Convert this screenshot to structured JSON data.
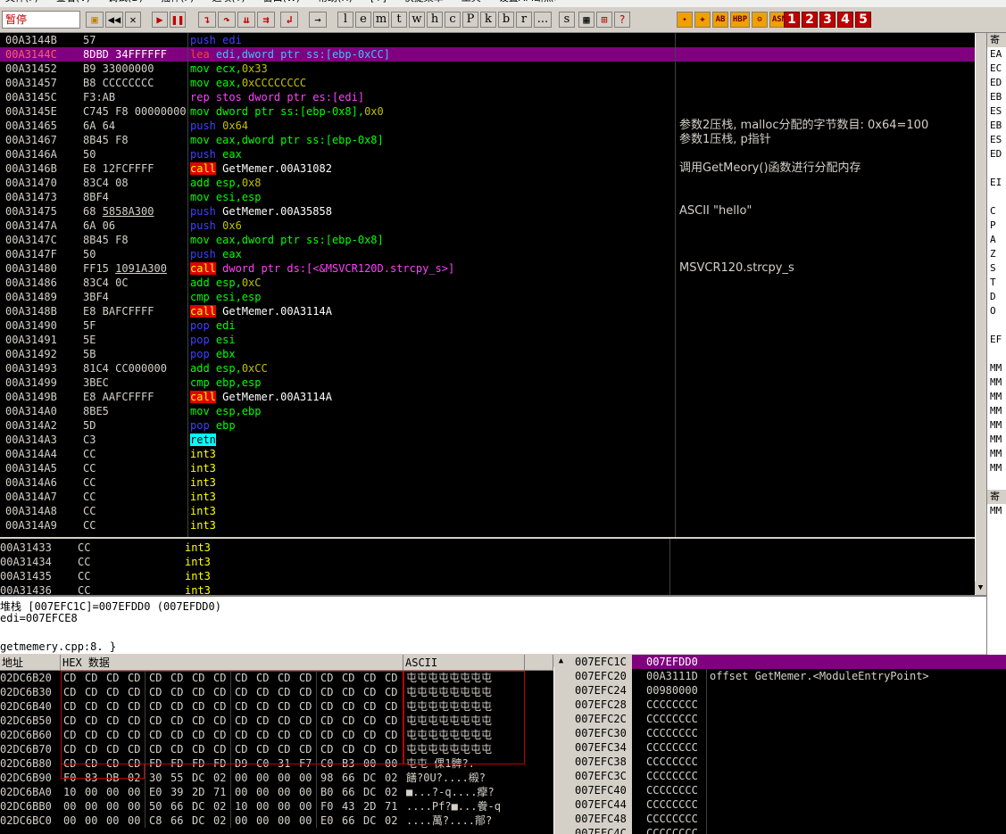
{
  "menu": {
    "items": [
      "文件(F)",
      "查看(V)",
      "调试(D)",
      "插件(P)",
      "选项(T)",
      "窗口(W)",
      "帮助(H)",
      "[+]",
      "快捷菜单",
      "工具",
      "设置API断点>"
    ]
  },
  "toolbar": {
    "status": "暂停",
    "letters": [
      "l",
      "e",
      "m",
      "t",
      "w",
      "h",
      "c",
      "P",
      "k",
      "b",
      "r",
      "...",
      "s"
    ],
    "plugins": [
      "HBP",
      "ASM"
    ],
    "numbers": [
      "1",
      "2",
      "3",
      "4",
      "5"
    ]
  },
  "disasm": [
    {
      "addr": "00A3144B",
      "hex": "57",
      "ins": [
        [
          "push",
          "c-push"
        ],
        [
          " edi",
          "c-push"
        ]
      ],
      "comment": ""
    },
    {
      "addr": "00A3144C",
      "hex": "8DBD 34FFFFFF",
      "ins": [
        [
          "lea",
          "c-rep"
        ],
        [
          " edi,dword ptr ss:[ebp-0xCC]",
          "c-push2"
        ]
      ],
      "comment": "",
      "selected": true
    },
    {
      "addr": "00A31452",
      "hex": "B9 33000000",
      "ins": [
        [
          "mov",
          "c-mov"
        ],
        [
          " ecx,",
          "c-mov"
        ],
        [
          "0x33",
          "num-y"
        ]
      ],
      "comment": ""
    },
    {
      "addr": "00A31457",
      "hex": "B8 CCCCCCCC",
      "ins": [
        [
          "mov",
          "c-mov"
        ],
        [
          " eax,",
          "c-mov"
        ],
        [
          "0xCCCCCCCC",
          "num-y"
        ]
      ],
      "comment": ""
    },
    {
      "addr": "00A3145C",
      "hex": "F3:AB",
      "ins": [
        [
          "rep stos dword ptr es:[edi]",
          "c-rep"
        ]
      ],
      "comment": ""
    },
    {
      "addr": "00A3145E",
      "hex": "C745 F8 00000000",
      "ins": [
        [
          "mov",
          "c-mov"
        ],
        [
          " dword ptr ss:[ebp-0x8],",
          "c-mov"
        ],
        [
          "0x0",
          "num-y"
        ]
      ],
      "comment": ""
    },
    {
      "addr": "00A31465",
      "hex": "6A 64",
      "ins": [
        [
          "push",
          "c-push"
        ],
        [
          " 0x64",
          "num-y"
        ]
      ],
      "comment": "参数2压栈, malloc分配的字节数目: 0x64=100"
    },
    {
      "addr": "00A31467",
      "hex": "8B45 F8",
      "ins": [
        [
          "mov",
          "c-mov"
        ],
        [
          " eax,dword ptr ss:[ebp-0x8]",
          "c-mov"
        ]
      ],
      "comment": "参数1压栈, p指针"
    },
    {
      "addr": "00A3146A",
      "hex": "50",
      "ins": [
        [
          "push",
          "c-push"
        ],
        [
          " eax",
          "c-mov"
        ]
      ],
      "comment": ""
    },
    {
      "addr": "00A3146B",
      "hex": "E8 12FCFFFF",
      "ins": [
        [
          "call",
          "c-call"
        ],
        [
          " GetMemer.00A31082",
          "white"
        ]
      ],
      "comment": "调用GetMeory()函数进行分配内存"
    },
    {
      "addr": "00A31470",
      "hex": "83C4 08",
      "ins": [
        [
          "add",
          "c-add"
        ],
        [
          " esp,",
          "c-add"
        ],
        [
          "0x8",
          "num-y"
        ]
      ],
      "comment": ""
    },
    {
      "addr": "00A31473",
      "hex": "8BF4",
      "ins": [
        [
          "mov",
          "c-mov"
        ],
        [
          " esi,esp",
          "c-mov"
        ]
      ],
      "comment": ""
    },
    {
      "addr": "00A31475",
      "hex": "68 5858A300",
      "ins": [
        [
          "push",
          "c-push"
        ],
        [
          " GetMemer.00A35858",
          "white"
        ]
      ],
      "comment": "ASCII \"hello\""
    },
    {
      "addr": "00A3147A",
      "hex": "6A 06",
      "ins": [
        [
          "push",
          "c-push"
        ],
        [
          " 0x6",
          "num-y"
        ]
      ],
      "comment": ""
    },
    {
      "addr": "00A3147C",
      "hex": "8B45 F8",
      "ins": [
        [
          "mov",
          "c-mov"
        ],
        [
          " eax,dword ptr ss:[ebp-0x8]",
          "c-mov"
        ]
      ],
      "comment": ""
    },
    {
      "addr": "00A3147F",
      "hex": "50",
      "ins": [
        [
          "push",
          "c-push"
        ],
        [
          " eax",
          "c-mov"
        ]
      ],
      "comment": ""
    },
    {
      "addr": "00A31480",
      "hex": "FF15 1091A300",
      "ins": [
        [
          "call",
          "c-call"
        ],
        [
          " dword ptr ds:[<&MSVCR120D.strcpy_s>]",
          "c-rep"
        ]
      ],
      "comment": "MSVCR120.strcpy_s"
    },
    {
      "addr": "00A31486",
      "hex": "83C4 0C",
      "ins": [
        [
          "add",
          "c-add"
        ],
        [
          " esp,",
          "c-add"
        ],
        [
          "0xC",
          "num-y"
        ]
      ],
      "comment": ""
    },
    {
      "addr": "00A31489",
      "hex": "3BF4",
      "ins": [
        [
          "cmp",
          "c-add"
        ],
        [
          " esi,esp",
          "c-add"
        ]
      ],
      "comment": ""
    },
    {
      "addr": "00A3148B",
      "hex": "E8 BAFCFFFF",
      "ins": [
        [
          "call",
          "c-call"
        ],
        [
          " GetMemer.00A3114A",
          "white"
        ]
      ],
      "comment": ""
    },
    {
      "addr": "00A31490",
      "hex": "5F",
      "ins": [
        [
          "pop",
          "c-push"
        ],
        [
          " edi",
          "c-mov"
        ]
      ],
      "comment": ""
    },
    {
      "addr": "00A31491",
      "hex": "5E",
      "ins": [
        [
          "pop",
          "c-push"
        ],
        [
          " esi",
          "c-mov"
        ]
      ],
      "comment": ""
    },
    {
      "addr": "00A31492",
      "hex": "5B",
      "ins": [
        [
          "pop",
          "c-push"
        ],
        [
          " ebx",
          "c-mov"
        ]
      ],
      "comment": ""
    },
    {
      "addr": "00A31493",
      "hex": "81C4 CC000000",
      "ins": [
        [
          "add",
          "c-add"
        ],
        [
          " esp,",
          "c-add"
        ],
        [
          "0xCC",
          "num-y"
        ]
      ],
      "comment": ""
    },
    {
      "addr": "00A31499",
      "hex": "3BEC",
      "ins": [
        [
          "cmp",
          "c-add"
        ],
        [
          " ebp,esp",
          "c-add"
        ]
      ],
      "comment": ""
    },
    {
      "addr": "00A3149B",
      "hex": "E8 AAFCFFFF",
      "ins": [
        [
          "call",
          "c-call"
        ],
        [
          " GetMemer.00A3114A",
          "white"
        ]
      ],
      "comment": ""
    },
    {
      "addr": "00A314A0",
      "hex": "8BE5",
      "ins": [
        [
          "mov",
          "c-mov"
        ],
        [
          " esp,ebp",
          "c-mov"
        ]
      ],
      "comment": ""
    },
    {
      "addr": "00A314A2",
      "hex": "5D",
      "ins": [
        [
          "pop",
          "c-push"
        ],
        [
          " ebp",
          "c-mov"
        ]
      ],
      "comment": ""
    },
    {
      "addr": "00A314A3",
      "hex": "C3",
      "ins": [
        [
          "retn",
          "c-retn"
        ]
      ],
      "comment": ""
    },
    {
      "addr": "00A314A4",
      "hex": "CC",
      "ins": [
        [
          "int3",
          "c-int3"
        ]
      ],
      "comment": ""
    },
    {
      "addr": "00A314A5",
      "hex": "CC",
      "ins": [
        [
          "int3",
          "c-int3"
        ]
      ],
      "comment": ""
    },
    {
      "addr": "00A314A6",
      "hex": "CC",
      "ins": [
        [
          "int3",
          "c-int3"
        ]
      ],
      "comment": ""
    },
    {
      "addr": "00A314A7",
      "hex": "CC",
      "ins": [
        [
          "int3",
          "c-int3"
        ]
      ],
      "comment": ""
    },
    {
      "addr": "00A314A8",
      "hex": "CC",
      "ins": [
        [
          "int3",
          "c-int3"
        ]
      ],
      "comment": ""
    },
    {
      "addr": "00A314A9",
      "hex": "CC",
      "ins": [
        [
          "int3",
          "c-int3"
        ]
      ],
      "comment": ""
    }
  ],
  "disasm_underlined": {
    "00A31475": "5858A300",
    "00A31480": "1091A300"
  },
  "disasm2": [
    {
      "addr": "00A31433",
      "hex": "CC",
      "ins": "int3"
    },
    {
      "addr": "00A31434",
      "hex": "CC",
      "ins": "int3"
    },
    {
      "addr": "00A31435",
      "hex": "CC",
      "ins": "int3"
    },
    {
      "addr": "00A31436",
      "hex": "CC",
      "ins": "int3"
    }
  ],
  "info": {
    "line1": "堆栈 [007EFC1C]=007EFDD0 (007EFDD0)",
    "line2": "edi=007EFCE8",
    "line3": "getmemery.cpp:8.  }"
  },
  "registers": [
    "寄",
    "EA",
    "EC",
    "ED",
    "EB",
    "ES",
    "EB",
    "ES",
    "ED",
    "",
    "EI",
    "",
    "C",
    "P",
    "A",
    "Z",
    "S",
    "T",
    "D",
    "O",
    "",
    "EF",
    "",
    "MM",
    "MM",
    "MM",
    "MM",
    "MM",
    "MM",
    "MM",
    "MM",
    "",
    "寄",
    "MM"
  ],
  "dump": {
    "col_addr": "地址",
    "col_hex": "HEX 数据",
    "col_ascii": "ASCII",
    "rows": [
      {
        "addr": "02DC6B20",
        "bytes": [
          "CD",
          "CD",
          "CD",
          "CD",
          "CD",
          "CD",
          "CD",
          "CD",
          "CD",
          "CD",
          "CD",
          "CD",
          "CD",
          "CD",
          "CD",
          "CD"
        ],
        "ascii": "屯屯屯屯屯屯屯屯"
      },
      {
        "addr": "02DC6B30",
        "bytes": [
          "CD",
          "CD",
          "CD",
          "CD",
          "CD",
          "CD",
          "CD",
          "CD",
          "CD",
          "CD",
          "CD",
          "CD",
          "CD",
          "CD",
          "CD",
          "CD"
        ],
        "ascii": "屯屯屯屯屯屯屯屯"
      },
      {
        "addr": "02DC6B40",
        "bytes": [
          "CD",
          "CD",
          "CD",
          "CD",
          "CD",
          "CD",
          "CD",
          "CD",
          "CD",
          "CD",
          "CD",
          "CD",
          "CD",
          "CD",
          "CD",
          "CD"
        ],
        "ascii": "屯屯屯屯屯屯屯屯"
      },
      {
        "addr": "02DC6B50",
        "bytes": [
          "CD",
          "CD",
          "CD",
          "CD",
          "CD",
          "CD",
          "CD",
          "CD",
          "CD",
          "CD",
          "CD",
          "CD",
          "CD",
          "CD",
          "CD",
          "CD"
        ],
        "ascii": "屯屯屯屯屯屯屯屯"
      },
      {
        "addr": "02DC6B60",
        "bytes": [
          "CD",
          "CD",
          "CD",
          "CD",
          "CD",
          "CD",
          "CD",
          "CD",
          "CD",
          "CD",
          "CD",
          "CD",
          "CD",
          "CD",
          "CD",
          "CD"
        ],
        "ascii": "屯屯屯屯屯屯屯屯"
      },
      {
        "addr": "02DC6B70",
        "bytes": [
          "CD",
          "CD",
          "CD",
          "CD",
          "CD",
          "CD",
          "CD",
          "CD",
          "CD",
          "CD",
          "CD",
          "CD",
          "CD",
          "CD",
          "CD",
          "CD"
        ],
        "ascii": "屯屯屯屯屯屯屯屯"
      },
      {
        "addr": "02DC6B80",
        "bytes": [
          "CD",
          "CD",
          "CD",
          "CD",
          "FD",
          "FD",
          "FD",
          "FD",
          "D9",
          "C0",
          "31",
          "F7",
          "C0",
          "B3",
          "00",
          "00"
        ],
        "ascii": "屯屯    倮1髀?."
      },
      {
        "addr": "02DC6B90",
        "bytes": [
          "F0",
          "83",
          "DB",
          "02",
          "30",
          "55",
          "DC",
          "02",
          "00",
          "00",
          "00",
          "00",
          "98",
          "66",
          "DC",
          "02"
        ],
        "ascii": "饍?0U?....榝?"
      },
      {
        "addr": "02DC6BA0",
        "bytes": [
          "10",
          "00",
          "00",
          "00",
          "E0",
          "39",
          "2D",
          "71",
          "00",
          "00",
          "00",
          "00",
          "B0",
          "66",
          "DC",
          "02"
        ],
        "ascii": "■...?-q....癴?"
      },
      {
        "addr": "02DC6BB0",
        "bytes": [
          "00",
          "00",
          "00",
          "00",
          "50",
          "66",
          "DC",
          "02",
          "10",
          "00",
          "00",
          "00",
          "F0",
          "43",
          "2D",
          "71"
        ],
        "ascii": "....Pf?■...餋-q"
      },
      {
        "addr": "02DC6BC0",
        "bytes": [
          "00",
          "00",
          "00",
          "00",
          "C8",
          "66",
          "DC",
          "02",
          "00",
          "00",
          "00",
          "00",
          "E0",
          "66",
          "DC",
          "02"
        ],
        "ascii": "....萬?....鄁?"
      }
    ]
  },
  "stack": {
    "header_addr": "007EFC1C",
    "header_val": "007EFDD0",
    "rows": [
      {
        "addr": "007EFC20",
        "val": "00A3111D",
        "comment": "offset GetMemer.<ModuleEntryPoint>"
      },
      {
        "addr": "007EFC24",
        "val": "00980000",
        "comment": ""
      },
      {
        "addr": "007EFC28",
        "val": "CCCCCCCC",
        "comment": ""
      },
      {
        "addr": "007EFC2C",
        "val": "CCCCCCCC",
        "comment": ""
      },
      {
        "addr": "007EFC30",
        "val": "CCCCCCCC",
        "comment": ""
      },
      {
        "addr": "007EFC34",
        "val": "CCCCCCCC",
        "comment": ""
      },
      {
        "addr": "007EFC38",
        "val": "CCCCCCCC",
        "comment": ""
      },
      {
        "addr": "007EFC3C",
        "val": "CCCCCCCC",
        "comment": ""
      },
      {
        "addr": "007EFC40",
        "val": "CCCCCCCC",
        "comment": ""
      },
      {
        "addr": "007EFC44",
        "val": "CCCCCCCC",
        "comment": ""
      },
      {
        "addr": "007EFC48",
        "val": "CCCCCCCC",
        "comment": ""
      },
      {
        "addr": "007EFC4C",
        "val": "CCCCCCCC",
        "comment": ""
      }
    ]
  }
}
